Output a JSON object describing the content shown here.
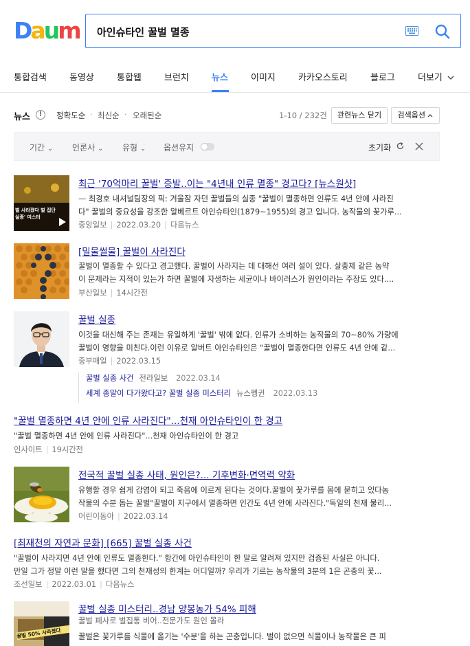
{
  "logo": {
    "letters": [
      "D",
      "a",
      "u",
      "m"
    ],
    "colors": [
      "#3b82f6",
      "#f6b40e",
      "#22c55e",
      "#ef4444"
    ]
  },
  "search": {
    "value": "아인슈타인 꿀벌 멸종",
    "keyboard_icon": "keyboard-icon",
    "search_icon": "search-icon"
  },
  "tabs": [
    {
      "label": "통합검색"
    },
    {
      "label": "동영상"
    },
    {
      "label": "통합웹"
    },
    {
      "label": "브런치"
    },
    {
      "label": "뉴스",
      "active": true
    },
    {
      "label": "이미지"
    },
    {
      "label": "카카오스토리"
    },
    {
      "label": "블로그"
    },
    {
      "label": "더보기"
    }
  ],
  "section": {
    "title": "뉴스",
    "info_icon": "!",
    "sort": [
      "정확도순",
      "최신순",
      "오래된순"
    ],
    "count": "1-10 / 232건",
    "related_btn": "관련뉴스 닫기",
    "options_btn": "검색옵션"
  },
  "filters": {
    "period": "기간",
    "press": "언론사",
    "type": "유형",
    "keep_option": "옵션유지",
    "reset": "초기화"
  },
  "results": [
    {
      "title": "최근 '70억마리 꿀벌' 증발..이는 \"4년내 인류 멸종\" 경고다? [뉴스원샷]",
      "desc1": "— 최경호 내셔널팀장의 픽: 겨울잠 자던 꿀벌들의 실종 \"꿀벌이 멸종하면 인류도 4년 안에 사라진",
      "desc2": "다\" 꿀벌의 중요성을 강조한 알베르트 아인슈타인(1879~1955)의 경고 입니다. 농작물의 꽃가루...",
      "source": "중앙일보",
      "date": "2022.03.20",
      "extra": "다음뉴스",
      "thumb_caption": "벌 사라졌다 벌 집단 실종' 미스터"
    },
    {
      "title": "[밀물썰물] 꿀벌이 사라진다",
      "desc1": "꿀벌이 멸종할 수 있다고 경고했다. 꿀벌이 사라지는 데 대해선 여러 설이 있다. 살충제 같은 농약",
      "desc2": "이 문제라는 지적이 있는가 하면 꿀벌에 자생하는 세균이나 바이러스가 원인이라는 주장도 있다....",
      "source": "부산일보",
      "date": "14시간전"
    },
    {
      "title": "꿀벌 실종",
      "desc1": "이것을 대신해 주는 존재는 유일하게 '꿀벌' 밖에 없다. 인류가 소비하는 농작물의 70~80% 가량에",
      "desc2": "꿀벌이 영향을 미친다.이런 이유로 알버트 아인슈타인은 \"꿀벌이 멸종한다면 인류도 4년 안에 같...",
      "source": "중부매일",
      "date": "2022.03.15",
      "related": [
        {
          "title": "꿀벌 실종 사건",
          "source": "전라일보",
          "date": "2022.03.14"
        },
        {
          "title": "세계 종말이 다가왔다고? 꿀벌 실종 미스터리",
          "source": "뉴스펭귄",
          "date": "2022.03.13"
        }
      ]
    },
    {
      "title": "\"꿀벌 멸종하면 4년 안에 인류 사라진다\"...천재 아인슈타인이 한 경고",
      "desc1": "\"꿀벌 멸종하면 4년 안에 인류 사라진다\"...천재 아인슈타인이 한 경고",
      "source": "인사이트",
      "date": "19시간전"
    },
    {
      "title": "전국적 꿀벌 실종 사태, 원인은?... 기후변화·면역력 약화",
      "desc1": "유행할 경우 쉽게 감염이 되고 죽음에 이르게 된다는 것이다.꿀벌이 꽃가루를 몸에 묻히고 있다농",
      "desc2": "작물의 수분 돕는 꿀벌\"꿀벌이 지구에서 멸종하면 인간도 4년 안에 사라진다.\"독일의 천재 물리...",
      "source": "어린이동아",
      "date": "2022.03.14"
    },
    {
      "title": "[최재천의 자연과 문화] [665] 꿀벌 실종 사건",
      "desc1": "\"꿀벌이 사라지면 4년 안에 인류도 멸종한다.\" 항간에 아인슈타인이 한 말로 알려져 있지만 검증된 사실은 아니다.",
      "desc2": "만일 그가 정말 이런 말을 했다면 그의 천재성의 한계는 어디일까? 우리가 기르는 농작물의 3분의 1은 곤충의 꽃...",
      "source": "조선일보",
      "date": "2022.03.01",
      "extra": "다음뉴스"
    },
    {
      "title": "꿀벌 실종 미스터리..경남 양봉농가 54% 피해",
      "sub": "꿀벌 폐사로 벌집통 비어..전문가도 원인 몰라",
      "desc1": "꿀벌은 꽃가루를 식물에 옮기는 '수분'을 하는 곤충입니다. 벌이 없으면 식물이나 농작물은 큰 피",
      "thumb_caption": "꿀벌 50% 사라졌다"
    }
  ]
}
